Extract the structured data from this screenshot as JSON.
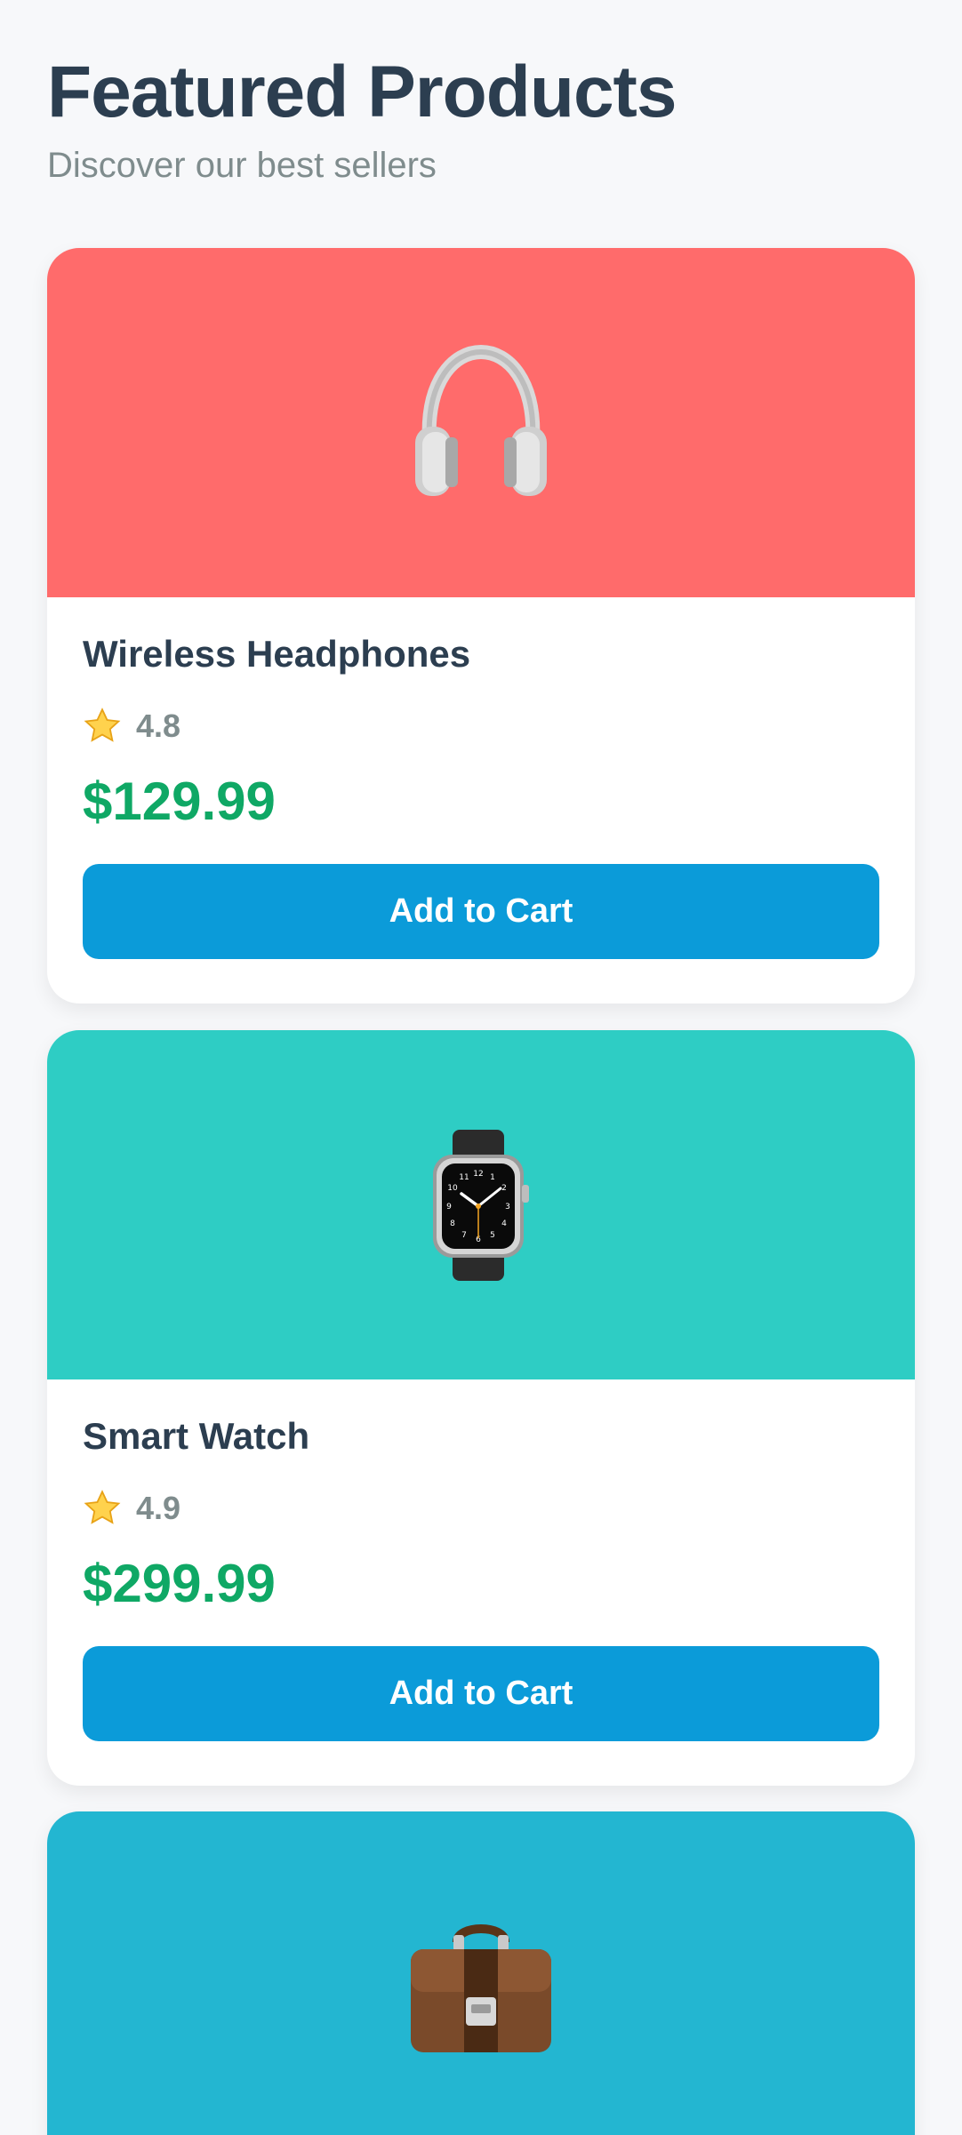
{
  "header": {
    "title": "Featured Products",
    "subtitle": "Discover our best sellers"
  },
  "products": [
    {
      "name": "Wireless Headphones",
      "rating": "4.8",
      "price": "$129.99",
      "button_label": "Add to Cart",
      "image_color": "#ff6b6b",
      "icon": "headphones-icon"
    },
    {
      "name": "Smart Watch",
      "rating": "4.9",
      "price": "$299.99",
      "button_label": "Add to Cart",
      "image_color": "#2ecdc4",
      "icon": "watch-icon"
    },
    {
      "name": "",
      "rating": "",
      "price": "",
      "button_label": "",
      "image_color": "#23b6d1",
      "icon": "briefcase-icon"
    }
  ],
  "colors": {
    "background": "#f7f8fa",
    "title": "#2c3e50",
    "subtitle": "#7f8c8d",
    "price": "#0fa865",
    "button": "#0b9bd9"
  }
}
